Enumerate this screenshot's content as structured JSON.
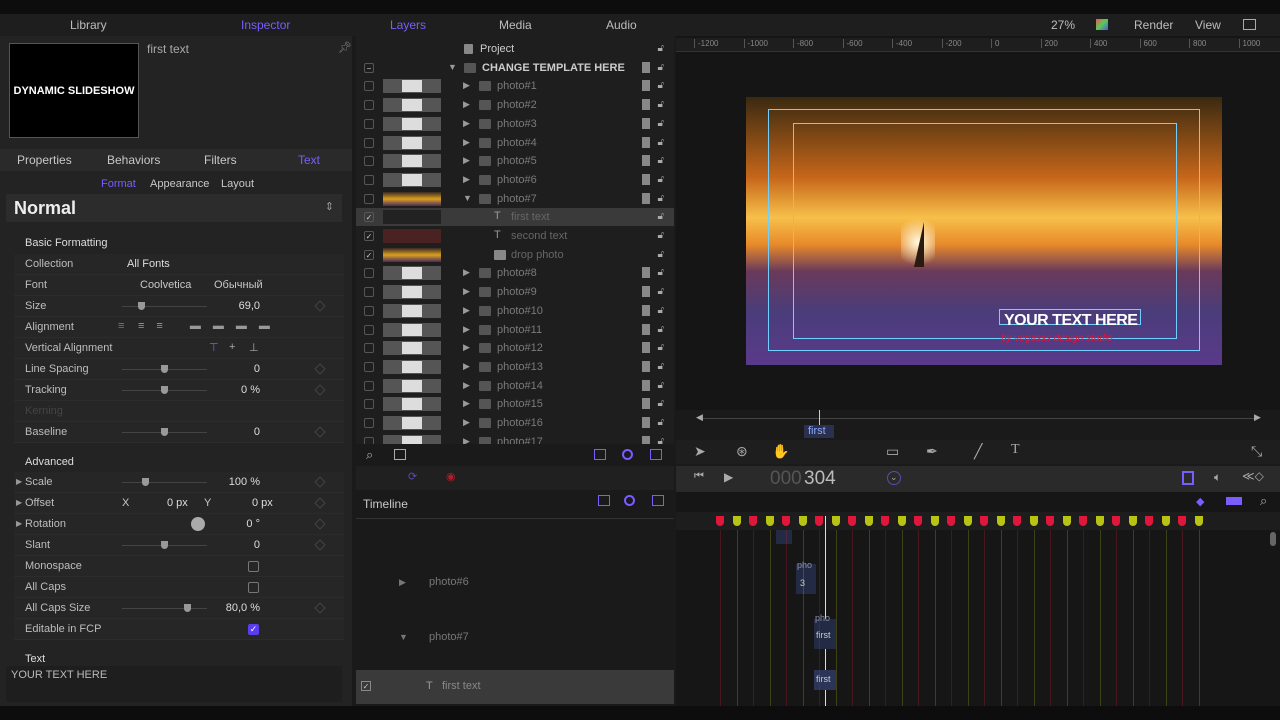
{
  "left_tabs": {
    "library": "Library",
    "inspector": "Inspector"
  },
  "preview": {
    "title": "DYNAMIC SLIDESHOW",
    "layer_name": "first text"
  },
  "inspector_tabs": [
    "Properties",
    "Behaviors",
    "Filters",
    "Text"
  ],
  "sub_tabs": [
    "Format",
    "Appearance",
    "Layout"
  ],
  "preset": "Normal",
  "basic": {
    "header": "Basic Formatting",
    "collection_label": "Collection",
    "collection": "All Fonts",
    "font_label": "Font",
    "font": "Coolvetica",
    "font_style": "Обычный",
    "size_label": "Size",
    "size": "69,0",
    "alignment_label": "Alignment",
    "valign_label": "Vertical Alignment",
    "line_spacing_label": "Line Spacing",
    "line_spacing": "0",
    "tracking_label": "Tracking",
    "tracking": "0 %",
    "kerning_label": "Kerning",
    "baseline_label": "Baseline",
    "baseline": "0"
  },
  "advanced": {
    "header": "Advanced",
    "scale_label": "Scale",
    "scale": "100 %",
    "offset_label": "Offset",
    "x_label": "X",
    "offset_x": "0 px",
    "y_label": "Y",
    "offset_y": "0 px",
    "rotation_label": "Rotation",
    "rotation": "0 °",
    "slant_label": "Slant",
    "slant": "0",
    "monospace_label": "Monospace",
    "monospace": false,
    "allcaps_label": "All Caps",
    "allcaps": false,
    "allcaps_size_label": "All Caps Size",
    "allcaps_size": "80,0 %",
    "fcp_label": "Editable in FCP",
    "fcp": true
  },
  "text_section": {
    "header": "Text",
    "value": "YOUR TEXT HERE"
  },
  "mid_tabs": {
    "layers": "Layers",
    "media": "Media",
    "audio": "Audio"
  },
  "layers": [
    {
      "name": "Project",
      "type": "project"
    },
    {
      "name": "CHANGE TEMPLATE HERE",
      "type": "group-root"
    },
    {
      "name": "photo#1",
      "type": "group"
    },
    {
      "name": "photo#2",
      "type": "group"
    },
    {
      "name": "photo#3",
      "type": "group"
    },
    {
      "name": "photo#4",
      "type": "group"
    },
    {
      "name": "photo#5",
      "type": "group"
    },
    {
      "name": "photo#6",
      "type": "group"
    },
    {
      "name": "photo#7",
      "type": "group-open"
    },
    {
      "name": "first text",
      "type": "text",
      "selected": true
    },
    {
      "name": "second text",
      "type": "text"
    },
    {
      "name": "drop photo",
      "type": "drop"
    },
    {
      "name": "photo#8",
      "type": "group"
    },
    {
      "name": "photo#9",
      "type": "group"
    },
    {
      "name": "photo#10",
      "type": "group"
    },
    {
      "name": "photo#11",
      "type": "group"
    },
    {
      "name": "photo#12",
      "type": "group"
    },
    {
      "name": "photo#13",
      "type": "group"
    },
    {
      "name": "photo#14",
      "type": "group"
    },
    {
      "name": "photo#15",
      "type": "group"
    },
    {
      "name": "photo#16",
      "type": "group"
    },
    {
      "name": "photo#17",
      "type": "group"
    }
  ],
  "canvas_toolbar": {
    "zoom": "27%",
    "render": "Render",
    "view": "View"
  },
  "ruler": [
    "-1200",
    "-1000",
    "-800",
    "-600",
    "-400",
    "-200",
    "0",
    "200",
    "400",
    "600",
    "800",
    "1000"
  ],
  "canvas_text": {
    "main": "YOUR TEXT HERE",
    "sub": "by vegasss design studio"
  },
  "mini_timeline": {
    "label": "first"
  },
  "transport": {
    "timecode_dim": "000",
    "timecode": "304"
  },
  "timeline": {
    "title": "Timeline",
    "tracks": [
      "photo#6",
      "photo#7",
      "first text"
    ],
    "clips": [
      "pho",
      "3",
      "pho",
      "first",
      "first"
    ]
  },
  "markers": [
    "#e0163b",
    "#b8c414",
    "#e0163b",
    "#b8c414",
    "#e0163b",
    "#b8c414",
    "#e0163b",
    "#b8c414",
    "#e0163b",
    "#b8c414",
    "#e0163b",
    "#b8c414",
    "#e0163b",
    "#b8c414",
    "#e0163b",
    "#b8c414",
    "#e0163b",
    "#b8c414",
    "#e0163b",
    "#b8c414",
    "#e0163b",
    "#b8c414",
    "#e0163b",
    "#b8c414",
    "#e0163b",
    "#b8c414",
    "#e0163b",
    "#b8c414",
    "#e0163b",
    "#b8c414"
  ],
  "colors": {
    "accent": "#7a5cff",
    "marker_red": "#e0163b",
    "marker_yellow": "#b8c414"
  }
}
